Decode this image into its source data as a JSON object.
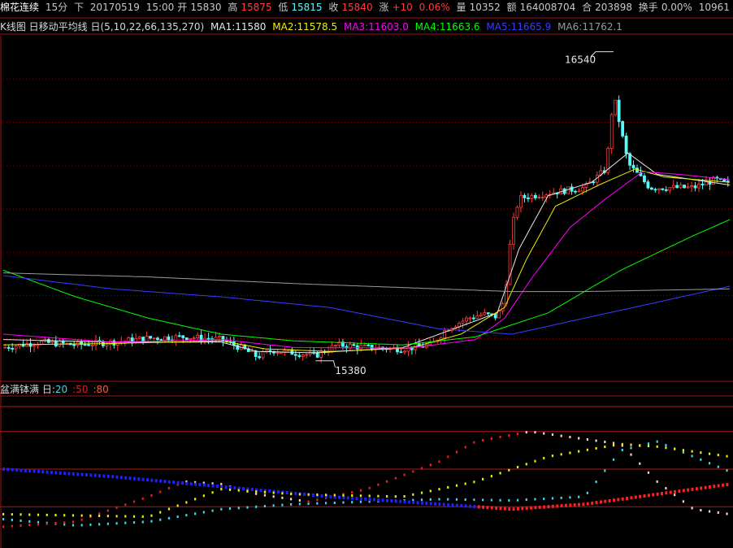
{
  "top_info": {
    "instrument": "棉花连续",
    "period": "15分",
    "direction": "下",
    "date": "20170519",
    "time": "15:00",
    "open_label": "开",
    "open": "15830",
    "high_label": "高",
    "high": "15875",
    "low_label": "低",
    "low": "15815",
    "close_label": "收",
    "close": "15840",
    "change_label": "涨",
    "change": "+10",
    "change_pct": "0.06%",
    "volume_label": "量",
    "volume": "10352",
    "amount_label": "额",
    "amount": "164008704",
    "oi_label": "合",
    "oi": "203898",
    "turnover_label": "换手",
    "turnover": "0.00%",
    "extra": "10961"
  },
  "ma_legend": {
    "prefix": "K线图 日移动平均线 日(5,10,22,66,135,270)",
    "items": [
      {
        "label": "MA1:11580",
        "color": "#e8e8e8"
      },
      {
        "label": "MA2:11578.5",
        "color": "#f0f000"
      },
      {
        "label": "MA3:11603.0",
        "color": "#ff00ff"
      },
      {
        "label": "MA4:11663.6",
        "color": "#00ff00"
      },
      {
        "label": "MA5:11665.9",
        "color": "#3a3aff"
      },
      {
        "label": "MA6:11762.1",
        "color": "#9a9a9a"
      }
    ]
  },
  "osc_legend": {
    "title": "盆满钵满 日:",
    "params": [
      {
        "label": "20",
        "color": "#3fd8e6"
      },
      {
        "label": ":50",
        "color": "#e02020"
      },
      {
        "label": ":80",
        "color": "#ff5a3a"
      }
    ]
  },
  "colors": {
    "up": "#ff3b3b",
    "down": "#54fcfc",
    "grid": "#8a0000",
    "frame": "#a01010"
  },
  "chart_data": [
    {
      "type": "candlestick",
      "x_range": [
        0,
        200
      ],
      "ylim": [
        15300,
        16600
      ],
      "annotations": [
        {
          "label": "16540",
          "x": 168,
          "y": 16540
        },
        {
          "label": "15380",
          "x": 86,
          "y": 15380
        }
      ],
      "price_path": [
        [
          0,
          15430
        ],
        [
          10,
          15450
        ],
        [
          20,
          15440
        ],
        [
          30,
          15450
        ],
        [
          40,
          15465
        ],
        [
          50,
          15470
        ],
        [
          60,
          15460
        ],
        [
          66,
          15425
        ],
        [
          70,
          15395
        ],
        [
          74,
          15420
        ],
        [
          80,
          15410
        ],
        [
          86,
          15400
        ],
        [
          92,
          15440
        ],
        [
          100,
          15430
        ],
        [
          110,
          15425
        ],
        [
          118,
          15440
        ],
        [
          122,
          15500
        ],
        [
          128,
          15540
        ],
        [
          132,
          15555
        ],
        [
          136,
          15545
        ],
        [
          138,
          15610
        ],
        [
          140,
          15880
        ],
        [
          142,
          15990
        ],
        [
          150,
          16010
        ],
        [
          160,
          16030
        ],
        [
          166,
          16100
        ],
        [
          168,
          16380
        ],
        [
          172,
          16120
        ],
        [
          178,
          16030
        ],
        [
          190,
          16030
        ],
        [
          196,
          16060
        ],
        [
          200,
          16040
        ]
      ],
      "series": [
        {
          "name": "MA1",
          "color": "#e8e8e8",
          "points": [
            [
              0,
              15460
            ],
            [
              30,
              15450
            ],
            [
              60,
              15450
            ],
            [
              70,
              15415
            ],
            [
              86,
              15410
            ],
            [
              110,
              15430
            ],
            [
              124,
              15500
            ],
            [
              136,
              15560
            ],
            [
              142,
              15800
            ],
            [
              150,
              16000
            ],
            [
              162,
              16050
            ],
            [
              172,
              16160
            ],
            [
              180,
              16080
            ],
            [
              200,
              16040
            ]
          ]
        },
        {
          "name": "MA2",
          "color": "#f0f000",
          "points": [
            [
              0,
              15440
            ],
            [
              30,
              15445
            ],
            [
              60,
              15455
            ],
            [
              72,
              15425
            ],
            [
              90,
              15415
            ],
            [
              112,
              15428
            ],
            [
              126,
              15480
            ],
            [
              138,
              15580
            ],
            [
              144,
              15760
            ],
            [
              152,
              15960
            ],
            [
              164,
              16040
            ],
            [
              174,
              16100
            ],
            [
              182,
              16070
            ],
            [
              200,
              16050
            ]
          ]
        },
        {
          "name": "MA3",
          "color": "#ff00ff",
          "points": [
            [
              0,
              15480
            ],
            [
              30,
              15450
            ],
            [
              60,
              15460
            ],
            [
              80,
              15430
            ],
            [
              112,
              15428
            ],
            [
              130,
              15460
            ],
            [
              138,
              15540
            ],
            [
              146,
              15700
            ],
            [
              156,
              15880
            ],
            [
              166,
              15990
            ],
            [
              176,
              16090
            ],
            [
              186,
              16080
            ],
            [
              200,
              16060
            ]
          ]
        },
        {
          "name": "MA4",
          "color": "#00ff00",
          "points": [
            [
              0,
              15720
            ],
            [
              20,
              15620
            ],
            [
              40,
              15540
            ],
            [
              60,
              15480
            ],
            [
              80,
              15455
            ],
            [
              110,
              15440
            ],
            [
              130,
              15470
            ],
            [
              150,
              15560
            ],
            [
              170,
              15720
            ],
            [
              190,
              15850
            ],
            [
              200,
              15910
            ]
          ]
        },
        {
          "name": "MA5",
          "color": "#3a3aff",
          "points": [
            [
              0,
              15700
            ],
            [
              30,
              15650
            ],
            [
              60,
              15620
            ],
            [
              90,
              15580
            ],
            [
              120,
              15500
            ],
            [
              140,
              15480
            ],
            [
              160,
              15540
            ],
            [
              180,
              15600
            ],
            [
              200,
              15660
            ]
          ]
        },
        {
          "name": "MA6",
          "color": "#9a9a9a",
          "points": [
            [
              0,
              15710
            ],
            [
              40,
              15695
            ],
            [
              80,
              15670
            ],
            [
              120,
              15650
            ],
            [
              140,
              15640
            ],
            [
              160,
              15640
            ],
            [
              200,
              15650
            ]
          ]
        }
      ]
    },
    {
      "type": "line",
      "x_range": [
        0,
        200
      ],
      "ylim": [
        0,
        100
      ],
      "reference_lines": [
        20,
        50,
        80
      ],
      "series": [
        {
          "name": "20",
          "color": "#3fd8e6",
          "points": [
            [
              0,
              10
            ],
            [
              20,
              5
            ],
            [
              40,
              8
            ],
            [
              60,
              18
            ],
            [
              80,
              22
            ],
            [
              120,
              26
            ],
            [
              140,
              25
            ],
            [
              160,
              28
            ],
            [
              170,
              65
            ],
            [
              180,
              72
            ],
            [
              190,
              60
            ],
            [
              200,
              48
            ]
          ]
        },
        {
          "name": ":50",
          "color": "#e02020",
          "points": [
            [
              0,
              4
            ],
            [
              20,
              8
            ],
            [
              40,
              28
            ],
            [
              50,
              40
            ],
            [
              60,
              38
            ],
            [
              70,
              30
            ],
            [
              84,
              24
            ],
            [
              100,
              34
            ],
            [
              120,
              56
            ],
            [
              130,
              72
            ],
            [
              145,
              80
            ],
            [
              170,
              70
            ],
            [
              180,
              40
            ],
            [
              190,
              18
            ],
            [
              200,
              14
            ]
          ]
        },
        {
          "name": ":80",
          "color": "#ff5a3a",
          "points": [
            [
              0,
              50
            ],
            [
              30,
              44
            ],
            [
              60,
              36
            ],
            [
              90,
              28
            ],
            [
              120,
              22
            ],
            [
              140,
              18
            ],
            [
              160,
              22
            ],
            [
              180,
              30
            ],
            [
              200,
              38
            ]
          ]
        },
        {
          "name": "ref",
          "color": "#f0f000",
          "points": [
            [
              0,
              14
            ],
            [
              40,
              12
            ],
            [
              60,
              34
            ],
            [
              80,
              30
            ],
            [
              110,
              28
            ],
            [
              130,
              40
            ],
            [
              150,
              60
            ],
            [
              170,
              70
            ],
            [
              180,
              68
            ],
            [
              200,
              60
            ]
          ]
        }
      ]
    }
  ]
}
